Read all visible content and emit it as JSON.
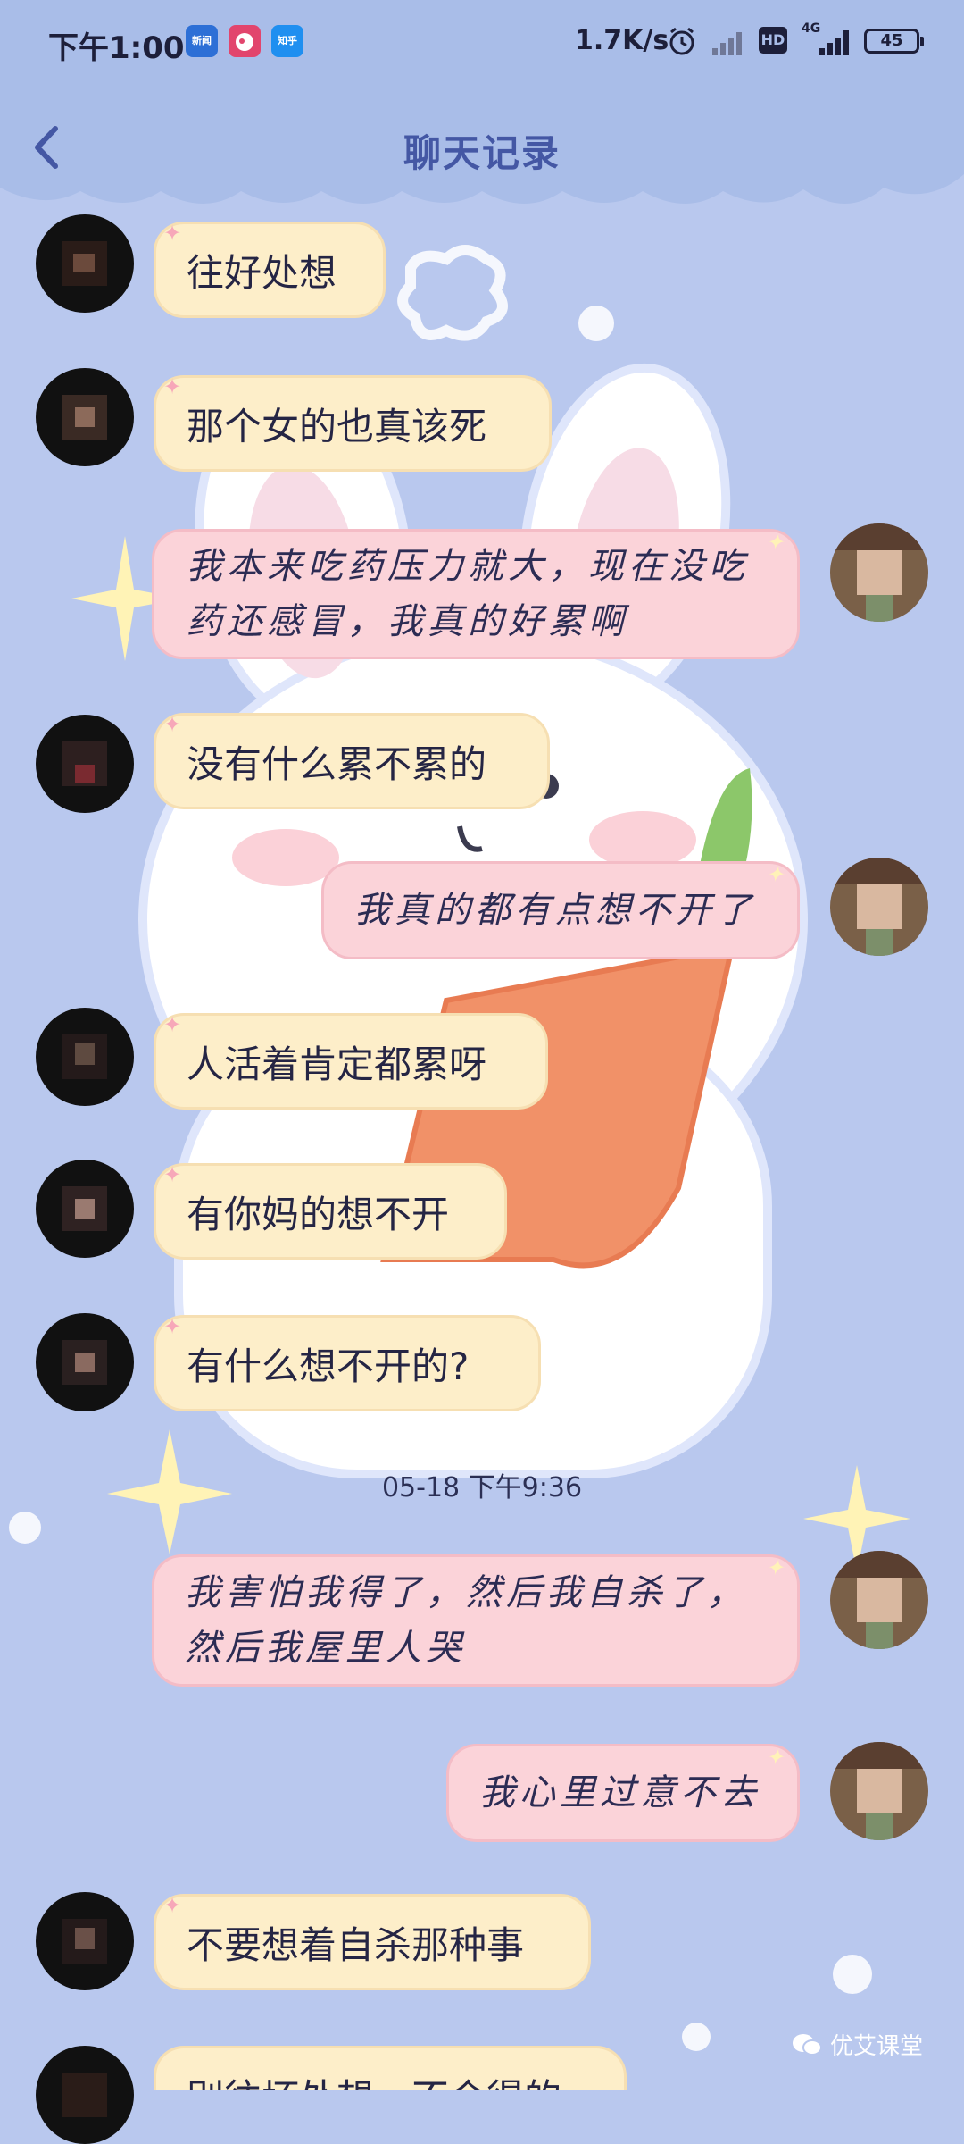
{
  "status_bar": {
    "time": "下午1:00",
    "apps": [
      {
        "name": "news-app-icon",
        "label": "新闻",
        "color": "#2d6fd6"
      },
      {
        "name": "weibo-app-icon",
        "label": "",
        "color": "#e2456d"
      },
      {
        "name": "zhihu-app-icon",
        "label": "知乎",
        "color": "#1f8ff0"
      }
    ],
    "network_speed": "1.7K/s",
    "hd_label": "HD",
    "network_type": "4G",
    "battery": "45"
  },
  "header": {
    "title": "聊天记录",
    "back_icon": "chevron-left-icon",
    "accent": "#4457a4"
  },
  "messages": [
    {
      "side": "left",
      "text": "往好处想"
    },
    {
      "side": "left",
      "text": "那个女的也真该死"
    },
    {
      "side": "right",
      "text": "我本来吃药压力就大，现在没吃药还感冒，我真的好累啊"
    },
    {
      "side": "left",
      "text": "没有什么累不累的"
    },
    {
      "side": "right",
      "text": "我真的都有点想不开了"
    },
    {
      "side": "left",
      "text": "人活着肯定都累呀"
    },
    {
      "side": "left",
      "text": "有你妈的想不开"
    },
    {
      "side": "left",
      "text": "有什么想不开的?"
    },
    {
      "side": "right",
      "text": "我害怕我得了，然后我自杀了，然后我屋里人哭"
    },
    {
      "side": "right",
      "text": "我心里过意不去"
    },
    {
      "side": "left",
      "text": "不要想着自杀那种事"
    },
    {
      "side": "left",
      "text": "别往坏处想，不会得的"
    }
  ],
  "timestamp": "05-18 下午9:36",
  "watermark": "优艾课堂",
  "colors": {
    "background": "#b9c8ee",
    "left_bubble": "#fdeec9",
    "right_bubble": "#fbd3d9"
  }
}
